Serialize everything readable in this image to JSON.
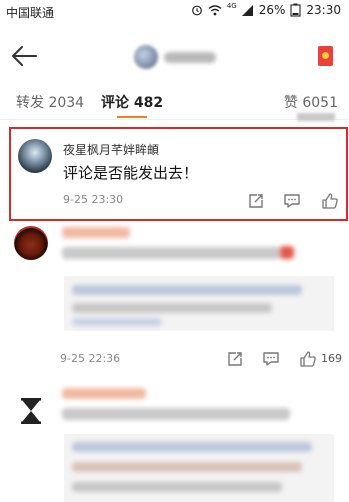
{
  "status_bar": {
    "carrier": "中国联通",
    "network": "4G",
    "battery": "26%",
    "time": "23:30"
  },
  "header": {
    "back_icon": "back-arrow-icon",
    "author_avatar": "avatar",
    "badge_icon": "red-envelope-icon"
  },
  "tabs": {
    "repost": "转发 2034",
    "comments": "评论 482",
    "likes": "赞 6051",
    "active": "comments",
    "accent": "#f08028"
  },
  "highlighted_comment": {
    "name": "夜星枫月芊姅眸頔",
    "text": "评论是否能发出去！",
    "time": "9-25 23:30",
    "actions": [
      "share-icon",
      "reply-icon",
      "like-icon"
    ],
    "border_color": "#d42b2b"
  },
  "comment_2": {
    "time": "9-25 22:36",
    "likes": "169",
    "actions": [
      "share-icon",
      "reply-icon",
      "like-icon"
    ]
  }
}
